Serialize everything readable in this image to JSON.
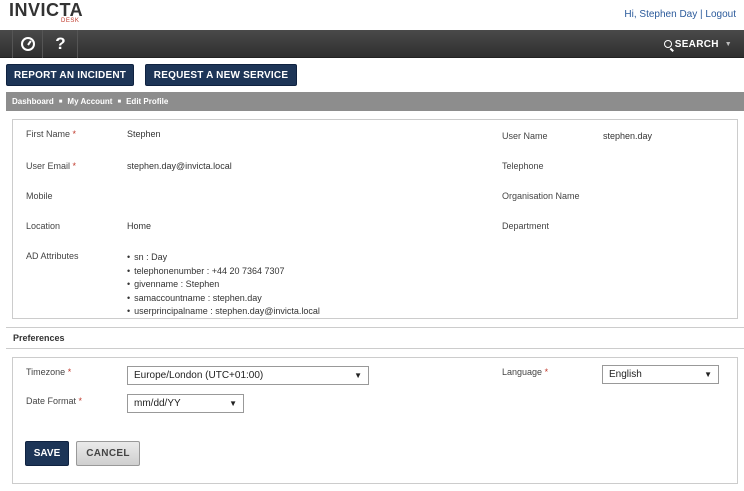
{
  "header": {
    "logo_main": "INVICTA",
    "logo_sub": "DESK",
    "greeting": "Hi, Stephen Day",
    "separator": "|",
    "logout": "Logout"
  },
  "nav": {
    "help_label": "?",
    "search_label": "SEARCH"
  },
  "actions": {
    "report_incident": "REPORT AN INCIDENT",
    "request_service": "REQUEST A NEW SERVICE"
  },
  "breadcrumb": {
    "items": [
      "Dashboard",
      "My Account",
      "Edit Profile"
    ],
    "separator": "■"
  },
  "profile": {
    "first_name_label": "First Name",
    "first_name": "Stephen",
    "user_email_label": "User Email",
    "user_email": "stephen.day@invicta.local",
    "mobile_label": "Mobile",
    "location_label": "Location",
    "location": "Home",
    "ad_attributes_label": "AD Attributes",
    "ad_attributes": [
      "sn : Day",
      "telephonenumber : +44 20 7364 7307",
      "givenname : Stephen",
      "samaccountname : stephen.day",
      "userprincipalname : stephen.day@invicta.local"
    ],
    "user_name_label": "User Name",
    "user_name": "stephen.day",
    "telephone_label": "Telephone",
    "organisation_label": "Organisation Name",
    "department_label": "Department",
    "required_marker": "*"
  },
  "preferences": {
    "title": "Preferences",
    "timezone_label": "Timezone",
    "timezone_value": "Europe/London (UTC+01:00)",
    "date_format_label": "Date Format",
    "date_format_value": "mm/dd/YY",
    "language_label": "Language",
    "language_value": "English",
    "dropdown_arrow": "▼"
  },
  "buttons": {
    "save": "SAVE",
    "cancel": "CANCEL"
  },
  "colors": {
    "accent": "#1d3557",
    "navbar": "#3a3a3a",
    "breadcrumb": "#8d8d8d",
    "required": "#c0392b",
    "link": "#2b5a9b"
  }
}
